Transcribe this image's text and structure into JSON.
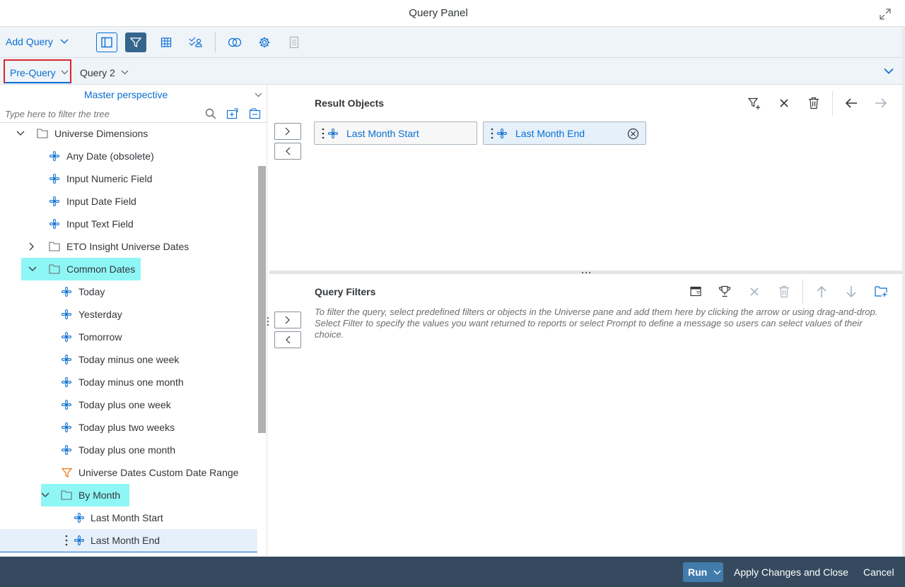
{
  "window": {
    "title": "Query Panel"
  },
  "toolbar": {
    "add_query_label": "Add Query"
  },
  "tabs": [
    {
      "label": "Pre-Query",
      "selected": true
    },
    {
      "label": "Query 2",
      "selected": false
    }
  ],
  "left_pane": {
    "perspective": "Master perspective",
    "filter_placeholder": "Type here to filter the tree",
    "tree": {
      "universe_dimensions": "Universe Dimensions",
      "any_date": "Any Date (obsolete)",
      "input_numeric_field": "Input Numeric Field",
      "input_date_field": "Input Date Field",
      "input_text_field": "Input Text Field",
      "eto_insight": "ETO Insight Universe Dates",
      "common_dates": "Common Dates",
      "today": "Today",
      "yesterday": "Yesterday",
      "tomorrow": "Tomorrow",
      "today_minus_week": "Today minus one week",
      "today_minus_month": "Today minus one month",
      "today_plus_week": "Today plus one week",
      "today_plus_two_weeks": "Today plus two weeks",
      "today_plus_month": "Today plus one month",
      "custom_date_range": "Universe Dates Custom Date Range",
      "by_month": "By Month",
      "last_month_start": "Last Month Start",
      "last_month_end": "Last Month End"
    }
  },
  "result_objects": {
    "title": "Result Objects",
    "items": [
      "Last Month Start",
      "Last Month End"
    ]
  },
  "query_filters": {
    "title": "Query Filters",
    "hint": "To filter the query, select predefined filters or objects in the Universe pane and add them here by clicking the arrow or using drag-and-drop. Select Filter to specify the values you want returned to reports or select Prompt to define a message so users can select values of their choice."
  },
  "footer": {
    "run_label": "Run",
    "apply_label": "Apply Changes and Close",
    "cancel_label": "Cancel"
  },
  "colors": {
    "accent": "#0a6ed1",
    "highlight": "#8ff6f6",
    "footer": "#354a5f",
    "selected_tab_border": "#d9262c"
  }
}
